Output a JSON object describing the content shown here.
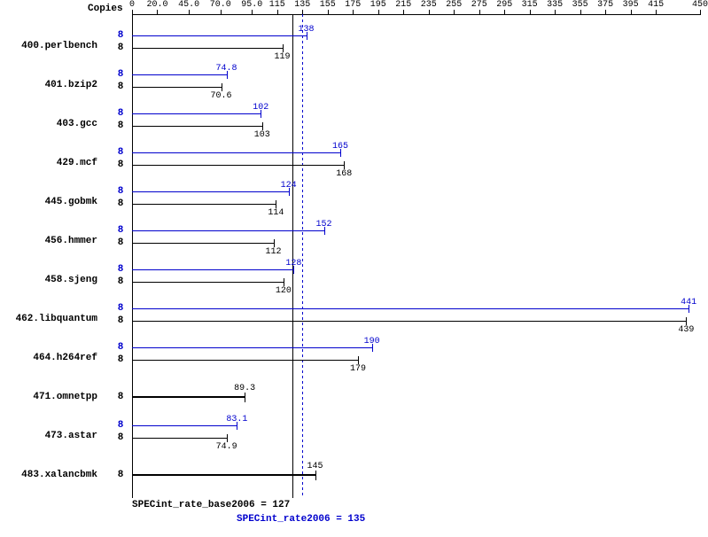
{
  "chart_data": {
    "type": "bar",
    "title": "",
    "xlabel": "",
    "ylabel": "",
    "copies_header": "Copies",
    "xlim": [
      0,
      450
    ],
    "x_ticks": [
      0,
      20.0,
      45.0,
      70.0,
      95.0,
      115,
      135,
      155,
      175,
      195,
      215,
      235,
      255,
      275,
      295,
      315,
      335,
      355,
      375,
      395,
      415,
      450
    ],
    "x_tick_labels": [
      "0",
      "20.0",
      "45.0",
      "70.0",
      "95.0",
      "115",
      "135",
      "155",
      "175",
      "195",
      "215",
      "235",
      "255",
      "275",
      "295",
      "315",
      "335",
      "355",
      "375",
      "395",
      "415",
      "450"
    ],
    "specint_rate_base": 127,
    "specint_rate_base_label": "SPECint_rate_base2006 = 127",
    "specint_rate_peak": 135,
    "specint_rate_peak_label": "SPECint_rate2006 = 135",
    "benchmarks": [
      {
        "name": "400.perlbench",
        "copies_peak": 8,
        "copies_base": 8,
        "peak": 138,
        "base": 119
      },
      {
        "name": "401.bzip2",
        "copies_peak": 8,
        "copies_base": 8,
        "peak": 74.8,
        "base": 70.6
      },
      {
        "name": "403.gcc",
        "copies_peak": 8,
        "copies_base": 8,
        "peak": 102,
        "base": 103
      },
      {
        "name": "429.mcf",
        "copies_peak": 8,
        "copies_base": 8,
        "peak": 165,
        "base": 168
      },
      {
        "name": "445.gobmk",
        "copies_peak": 8,
        "copies_base": 8,
        "peak": 124,
        "base": 114
      },
      {
        "name": "456.hmmer",
        "copies_peak": 8,
        "copies_base": 8,
        "peak": 152,
        "base": 112
      },
      {
        "name": "458.sjeng",
        "copies_peak": 8,
        "copies_base": 8,
        "peak": 128,
        "base": 120
      },
      {
        "name": "462.libquantum",
        "copies_peak": 8,
        "copies_base": 8,
        "peak": 441,
        "base": 439
      },
      {
        "name": "464.h264ref",
        "copies_peak": 8,
        "copies_base": 8,
        "peak": 190,
        "base": 179
      },
      {
        "name": "471.omnetpp",
        "copies_peak": null,
        "copies_base": 8,
        "peak": null,
        "base": 89.3,
        "single": true
      },
      {
        "name": "473.astar",
        "copies_peak": 8,
        "copies_base": 8,
        "peak": 83.1,
        "base": 74.9
      },
      {
        "name": "483.xalancbmk",
        "copies_peak": null,
        "copies_base": 8,
        "peak": null,
        "base": 145,
        "single": true
      }
    ]
  }
}
